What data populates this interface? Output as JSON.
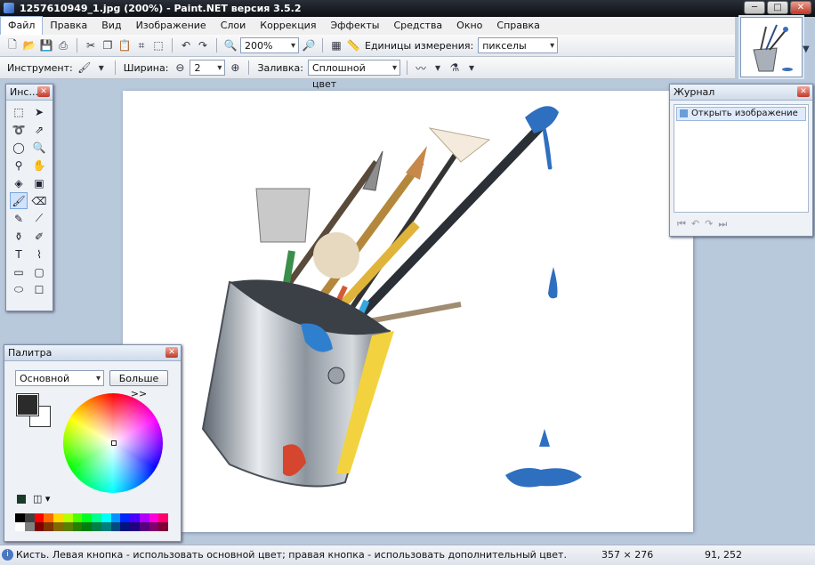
{
  "window": {
    "title": "1257610949_1.jpg (200%) - Paint.NET версия 3.5.2",
    "btn_min": "─",
    "btn_max": "□",
    "btn_close": "✕"
  },
  "menu": [
    "Файл",
    "Правка",
    "Вид",
    "Изображение",
    "Слои",
    "Коррекция",
    "Эффекты",
    "Средства",
    "Окно",
    "Справка"
  ],
  "toolbar1": {
    "zoom": "200%",
    "units_label": "Единицы измерения:",
    "units_value": "пикселы"
  },
  "toolbar2": {
    "tool_label": "Инструмент:",
    "width_label": "Ширина:",
    "width_value": "2",
    "fill_label": "Заливка:",
    "fill_value": "Сплошной цвет"
  },
  "tools_panel": {
    "title": "Инс...",
    "tools": [
      "rect-select-icon",
      "move-selection-icon",
      "lasso-icon",
      "move-selected-icon",
      "ellipse-select-icon",
      "zoom-icon",
      "magic-wand-icon",
      "pan-icon",
      "paint-bucket-icon",
      "gradient-icon",
      "paintbrush-icon",
      "eraser-icon",
      "pencil-icon",
      "color-picker-icon",
      "clone-stamp-icon",
      "recolor-icon",
      "text-icon",
      "line-curve-icon",
      "rectangle-icon",
      "rounded-rectangle-icon",
      "ellipse-icon",
      "freeform-shape-icon"
    ],
    "selected": "paintbrush-icon"
  },
  "journal_panel": {
    "title": "Журнал",
    "items": [
      "Открыть изображение"
    ]
  },
  "palette_panel": {
    "title": "Палитра",
    "mode": "Основной",
    "more_button": "Больше >>",
    "primary_color": "#2b2b2b",
    "secondary_color": "#ffffff",
    "swatches": [
      "#000000",
      "#404040",
      "#ff0000",
      "#ff6a00",
      "#ffd800",
      "#b6ff00",
      "#4cff00",
      "#00ff21",
      "#00ff90",
      "#00ffff",
      "#0094ff",
      "#0026ff",
      "#4800ff",
      "#b200ff",
      "#ff00dc",
      "#ff006e",
      "#ffffff",
      "#808080",
      "#7f0000",
      "#7f3300",
      "#7f6a00",
      "#5b7f00",
      "#267f00",
      "#007f0e",
      "#007f46",
      "#007f7f",
      "#004a7f",
      "#00137f",
      "#21007f",
      "#57007f",
      "#7f006e",
      "#7f0037"
    ]
  },
  "status": {
    "message": "Кисть. Левая кнопка - использовать основной цвет; правая кнопка - использовать дополнительный цвет.",
    "image_size": "357 × 276",
    "cursor_pos": "91, 252"
  }
}
